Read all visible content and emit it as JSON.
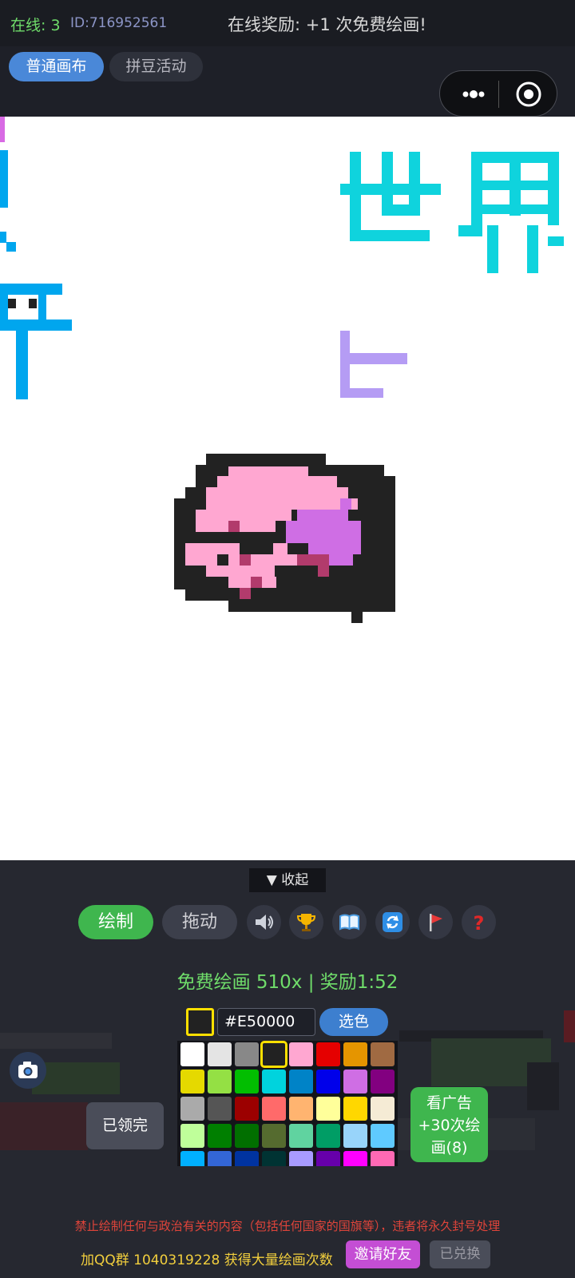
{
  "header": {
    "online": "在线: 3",
    "user_id": "ID:716952561",
    "reward_banner": "在线奖励: +1 次免费绘画!"
  },
  "tabs": [
    {
      "label": "普通画布",
      "active": true
    },
    {
      "label": "拼豆活动",
      "active": false
    }
  ],
  "canvas": {
    "text_world": "世界"
  },
  "panel": {
    "collapse_label": "▼ 收起",
    "tools": {
      "draw": "绘制",
      "drag": "拖动"
    },
    "icons": [
      "speaker-icon",
      "trophy-icon",
      "book-icon",
      "refresh-icon",
      "flag-icon",
      "help-icon"
    ],
    "free_draw_status": "免费绘画 510x | 奖励1:52",
    "current_color_hex": "#E50000",
    "pick_color_label": "选色",
    "claimed_label": "已领完",
    "ad_label": "看广告+30次绘画(8)",
    "palette": [
      "#ffffff",
      "#e4e4e4",
      "#888888",
      "#222222",
      "#ffa7d1",
      "#e50000",
      "#e59500",
      "#a06a42",
      "#e5d900",
      "#94e044",
      "#02be01",
      "#00d3dd",
      "#0083c7",
      "#0000ea",
      "#cf6ee4",
      "#820080",
      "#aaaaaa",
      "#555555",
      "#9c0000",
      "#ff6a6a",
      "#ffb470",
      "#ffff9a",
      "#ffd700",
      "#f5ebd5",
      "#bfff9a",
      "#007f00",
      "#016f00",
      "#556b2f",
      "#60d3a0",
      "#009d65",
      "#98d4fa",
      "#5fcaff",
      "#00b0ff",
      "#3366d6",
      "#0033a0",
      "#003333",
      "#a89bff",
      "#6600aa",
      "#ff00ff",
      "#ff69b4",
      "#cc3366",
      "#993366",
      "#ffdfba",
      "#e0b070",
      "#8b5a2b",
      "#ff7f50",
      "#c0c0c0",
      "#330000"
    ],
    "selected_swatch": 3
  },
  "footer": {
    "warning": "禁止绘制任何与政治有关的内容（包括任何国家的国旗等），违者将永久封号处理",
    "qq_group": "加QQ群 1040319228 获得大量绘画次数",
    "invite_label": "邀请好友",
    "redeemed_label": "已兑换"
  },
  "colors": {
    "accent_green": "#3fb64e",
    "accent_blue": "#4a88d8",
    "world_text": "#0fd3dd",
    "pink": "#ffa7d1",
    "purple": "#cf6ee4"
  }
}
